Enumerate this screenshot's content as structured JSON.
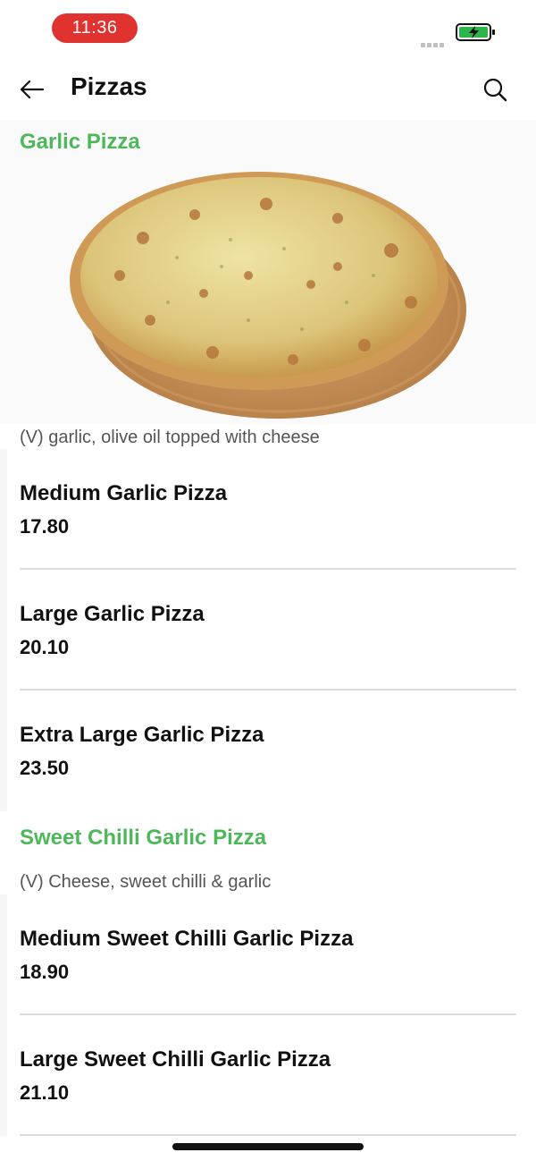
{
  "status_bar": {
    "time": "11:36",
    "battery_color": "#2bb54a"
  },
  "header": {
    "title": "Pizzas",
    "icons": {
      "back": "back-arrow-icon",
      "search": "search-icon"
    }
  },
  "accent_color": "#4db85a",
  "sections": [
    {
      "title": "Garlic Pizza",
      "description": "(V) garlic, olive oil topped with cheese",
      "items": [
        {
          "name": "Medium Garlic Pizza",
          "price": "17.80"
        },
        {
          "name": "Large Garlic Pizza",
          "price": "20.10"
        },
        {
          "name": "Extra Large Garlic Pizza",
          "price": "23.50"
        }
      ]
    },
    {
      "title": "Sweet Chilli Garlic Pizza",
      "description": "(V) Cheese, sweet chilli & garlic",
      "items": [
        {
          "name": "Medium Sweet Chilli Garlic Pizza",
          "price": "18.90"
        },
        {
          "name": "Large Sweet Chilli Garlic Pizza",
          "price": "21.10"
        }
      ]
    }
  ]
}
